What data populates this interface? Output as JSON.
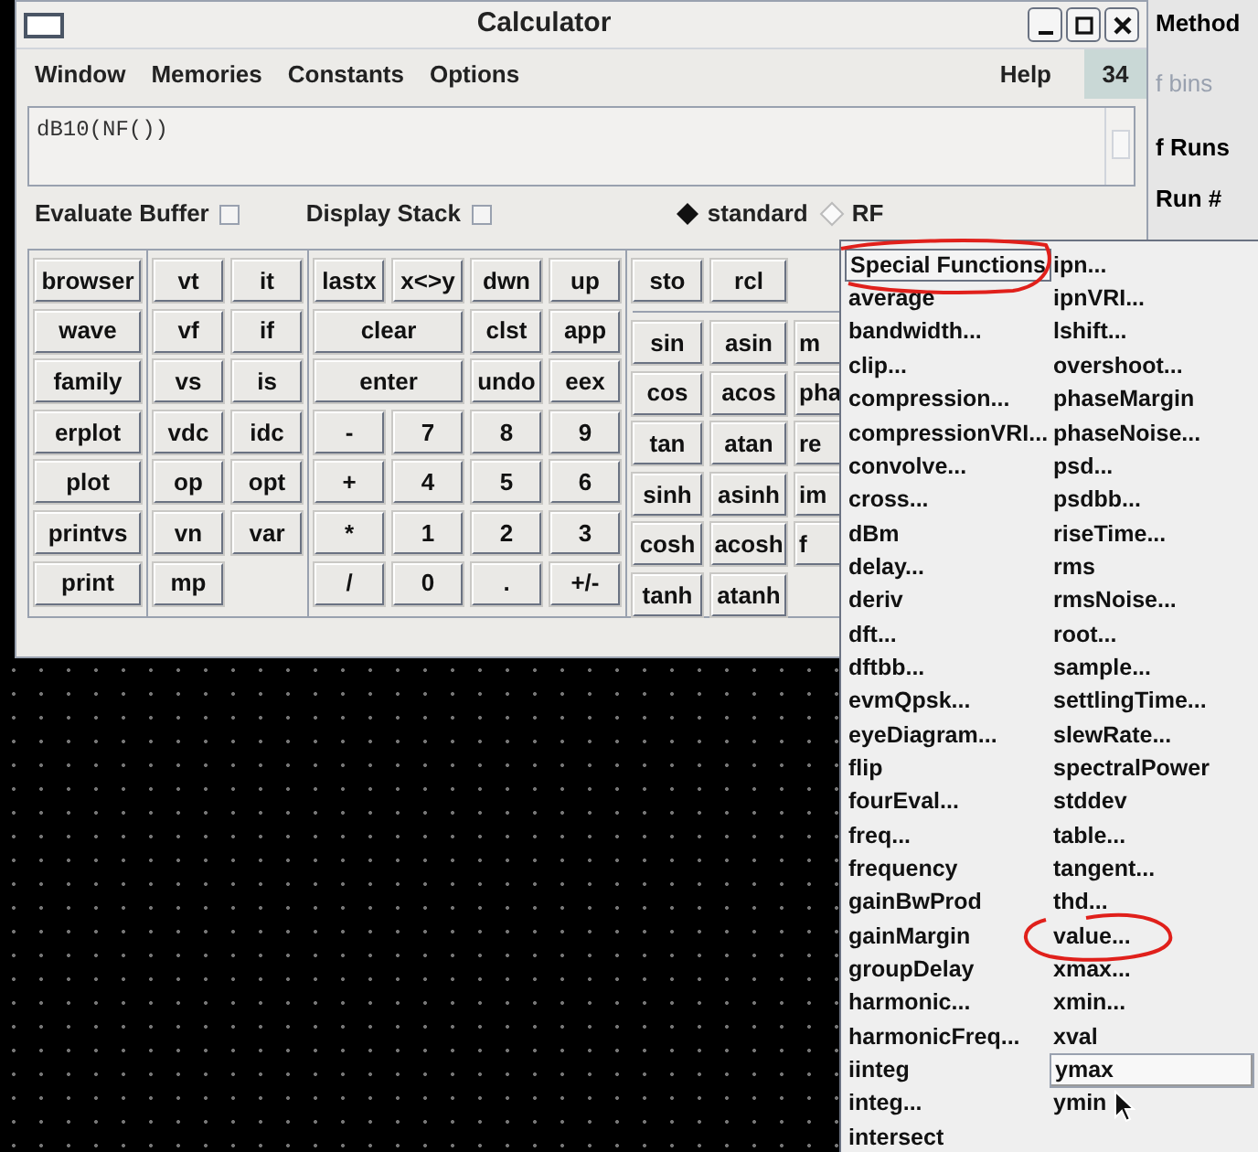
{
  "window": {
    "title": "Calculator"
  },
  "menubar": {
    "items": [
      "Window",
      "Memories",
      "Constants",
      "Options"
    ],
    "help": "Help",
    "counter": "34"
  },
  "buffer": {
    "value": "dB10(NF())"
  },
  "options": [
    {
      "label": "Evaluate Buffer",
      "checked": false
    },
    {
      "label": "Display Stack",
      "checked": false
    }
  ],
  "mode": [
    {
      "label": "standard",
      "selected": true
    },
    {
      "label": "RF",
      "selected": false
    }
  ],
  "button_groups": [
    {
      "buttons": [
        {
          "label": "browser"
        },
        {
          "label": "wave"
        },
        {
          "label": "family"
        },
        {
          "label": "erplot"
        },
        {
          "label": "plot"
        },
        {
          "label": "printvs"
        },
        {
          "label": "print"
        }
      ]
    },
    {
      "buttons": [
        {
          "label": "vt"
        },
        {
          "label": "it"
        },
        {
          "label": "vf"
        },
        {
          "label": "if"
        },
        {
          "label": "vs"
        },
        {
          "label": "is"
        },
        {
          "label": "vdc"
        },
        {
          "label": "idc"
        },
        {
          "label": "op"
        },
        {
          "label": "opt"
        },
        {
          "label": "vn"
        },
        {
          "label": "var"
        },
        {
          "label": "mp"
        }
      ]
    },
    {
      "buttons": [
        {
          "label": "lastx"
        },
        {
          "label": "x<>y"
        },
        {
          "label": "dwn"
        },
        {
          "label": "up"
        },
        {
          "label": "clear",
          "kind": "wide"
        },
        {
          "label": "clst"
        },
        {
          "label": "app"
        },
        {
          "label": "enter",
          "kind": "wide"
        },
        {
          "label": "undo"
        },
        {
          "label": "eex"
        },
        {
          "label": "-"
        },
        {
          "label": "7"
        },
        {
          "label": "8"
        },
        {
          "label": "9"
        },
        {
          "label": "+"
        },
        {
          "label": "4"
        },
        {
          "label": "5"
        },
        {
          "label": "6"
        },
        {
          "label": "*"
        },
        {
          "label": "1"
        },
        {
          "label": "2"
        },
        {
          "label": "3"
        },
        {
          "label": "/"
        },
        {
          "label": "0"
        },
        {
          "label": "."
        },
        {
          "label": "+/-"
        }
      ]
    },
    {
      "top": [
        {
          "label": "sto"
        },
        {
          "label": "rcl"
        }
      ],
      "buttons": [
        {
          "label": "sin"
        },
        {
          "label": "asin"
        },
        {
          "label": "m"
        },
        {
          "label": "cos"
        },
        {
          "label": "acos"
        },
        {
          "label": "pha"
        },
        {
          "label": "tan"
        },
        {
          "label": "atan"
        },
        {
          "label": "re"
        },
        {
          "label": "sinh"
        },
        {
          "label": "asinh"
        },
        {
          "label": "im"
        },
        {
          "label": "cosh"
        },
        {
          "label": "acosh"
        },
        {
          "label": "f"
        },
        {
          "label": "tanh"
        },
        {
          "label": "atanh"
        }
      ]
    }
  ],
  "background_panel": {
    "items": [
      {
        "label": "Method",
        "disabled": false
      },
      {
        "label": "f bins",
        "disabled": true
      },
      {
        "label": "f Runs",
        "disabled": false
      },
      {
        "label": "Run #",
        "disabled": false
      }
    ]
  },
  "popup_menu": {
    "items": [
      {
        "label": "Special Functions",
        "kind": "header",
        "circled": true,
        "selected": false
      },
      {
        "label": "average",
        "kind": "item",
        "circled": false,
        "selected": false
      },
      {
        "label": "bandwidth...",
        "kind": "item",
        "circled": false,
        "selected": false
      },
      {
        "label": "clip...",
        "kind": "item",
        "circled": false,
        "selected": false
      },
      {
        "label": "compression...",
        "kind": "item",
        "circled": false,
        "selected": false
      },
      {
        "label": "compressionVRI...",
        "kind": "item",
        "circled": false,
        "selected": false
      },
      {
        "label": "convolve...",
        "kind": "item",
        "circled": false,
        "selected": false
      },
      {
        "label": "cross...",
        "kind": "item",
        "circled": false,
        "selected": false
      },
      {
        "label": "dBm",
        "kind": "item",
        "circled": false,
        "selected": false
      },
      {
        "label": "delay...",
        "kind": "item",
        "circled": false,
        "selected": false
      },
      {
        "label": "deriv",
        "kind": "item",
        "circled": false,
        "selected": false
      },
      {
        "label": "dft...",
        "kind": "item",
        "circled": false,
        "selected": false
      },
      {
        "label": "dftbb...",
        "kind": "item",
        "circled": false,
        "selected": false
      },
      {
        "label": "evmQpsk...",
        "kind": "item",
        "circled": false,
        "selected": false
      },
      {
        "label": "eyeDiagram...",
        "kind": "item",
        "circled": false,
        "selected": false
      },
      {
        "label": "flip",
        "kind": "item",
        "circled": false,
        "selected": false
      },
      {
        "label": "fourEval...",
        "kind": "item",
        "circled": false,
        "selected": false
      },
      {
        "label": "freq...",
        "kind": "item",
        "circled": false,
        "selected": false
      },
      {
        "label": "frequency",
        "kind": "item",
        "circled": false,
        "selected": false
      },
      {
        "label": "gainBwProd",
        "kind": "item",
        "circled": false,
        "selected": false
      },
      {
        "label": "gainMargin",
        "kind": "item",
        "circled": false,
        "selected": false
      },
      {
        "label": "groupDelay",
        "kind": "item",
        "circled": false,
        "selected": false
      },
      {
        "label": "harmonic...",
        "kind": "item",
        "circled": false,
        "selected": false
      },
      {
        "label": "harmonicFreq...",
        "kind": "item",
        "circled": false,
        "selected": false
      },
      {
        "label": "iinteg",
        "kind": "item",
        "circled": false,
        "selected": false
      },
      {
        "label": "integ...",
        "kind": "item",
        "circled": false,
        "selected": false
      },
      {
        "label": "intersect",
        "kind": "item",
        "circled": false,
        "selected": false
      },
      {
        "label": "ipn...",
        "kind": "item",
        "circled": false,
        "selected": false
      },
      {
        "label": "ipnVRI...",
        "kind": "item",
        "circled": false,
        "selected": false
      },
      {
        "label": "lshift...",
        "kind": "item",
        "circled": false,
        "selected": false
      },
      {
        "label": "overshoot...",
        "kind": "item",
        "circled": false,
        "selected": false
      },
      {
        "label": "phaseMargin",
        "kind": "item",
        "circled": false,
        "selected": false
      },
      {
        "label": "phaseNoise...",
        "kind": "item",
        "circled": false,
        "selected": false
      },
      {
        "label": "psd...",
        "kind": "item",
        "circled": false,
        "selected": false
      },
      {
        "label": "psdbb...",
        "kind": "item",
        "circled": false,
        "selected": false
      },
      {
        "label": "riseTime...",
        "kind": "item",
        "circled": false,
        "selected": false
      },
      {
        "label": "rms",
        "kind": "item",
        "circled": false,
        "selected": false
      },
      {
        "label": "rmsNoise...",
        "kind": "item",
        "circled": false,
        "selected": false
      },
      {
        "label": "root...",
        "kind": "item",
        "circled": false,
        "selected": false
      },
      {
        "label": "sample...",
        "kind": "item",
        "circled": false,
        "selected": false
      },
      {
        "label": "settlingTime...",
        "kind": "item",
        "circled": false,
        "selected": false
      },
      {
        "label": "slewRate...",
        "kind": "item",
        "circled": false,
        "selected": false
      },
      {
        "label": "spectralPower",
        "kind": "item",
        "circled": false,
        "selected": false
      },
      {
        "label": "stddev",
        "kind": "item",
        "circled": false,
        "selected": false
      },
      {
        "label": "table...",
        "kind": "item",
        "circled": false,
        "selected": false
      },
      {
        "label": "tangent...",
        "kind": "item",
        "circled": false,
        "selected": false
      },
      {
        "label": "thd...",
        "kind": "item",
        "circled": false,
        "selected": false
      },
      {
        "label": "value...",
        "kind": "item",
        "circled": true,
        "selected": false
      },
      {
        "label": "xmax...",
        "kind": "item",
        "circled": false,
        "selected": false
      },
      {
        "label": "xmin...",
        "kind": "item",
        "circled": false,
        "selected": false
      },
      {
        "label": "xval",
        "kind": "item",
        "circled": false,
        "selected": false
      },
      {
        "label": "ymax",
        "kind": "item",
        "circled": false,
        "selected": true
      },
      {
        "label": "ymin",
        "kind": "item",
        "circled": false,
        "selected": false
      }
    ]
  }
}
